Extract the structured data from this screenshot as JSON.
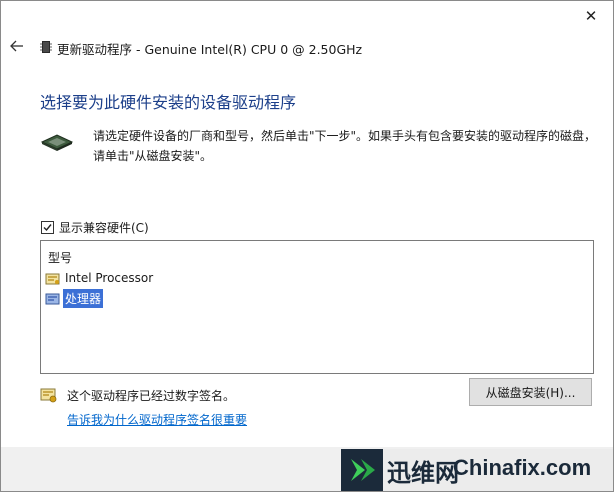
{
  "window": {
    "title": "更新驱动程序 - Genuine Intel(R) CPU 0 @ 2.50GHz",
    "close_glyph": "✕",
    "back_glyph": "←"
  },
  "main": {
    "heading": "选择要为此硬件安装的设备驱动程序",
    "description_line1": "请选定硬件设备的厂商和型号，然后单击\"下一步\"。如果手头有包含要安装的驱动程序的磁盘，",
    "description_line2": "请单击\"从磁盘安装\"。"
  },
  "compat_checkbox": {
    "label": "显示兼容硬件(C)",
    "checked": true
  },
  "model_list": {
    "header": "型号",
    "items": [
      {
        "label": "Intel Processor",
        "selected": false
      },
      {
        "label": "处理器",
        "selected": true
      }
    ]
  },
  "signature": {
    "text": "这个驱动程序已经过数字签名。",
    "link": "告诉我为什么驱动程序签名很重要"
  },
  "buttons": {
    "have_disk": "从磁盘安装(H)..."
  },
  "watermark": {
    "cn": "迅维网",
    "en": "Chinafix.com"
  },
  "colors": {
    "heading": "#1c3f8a",
    "link": "#0066cc",
    "selection": "#3c70d6"
  }
}
